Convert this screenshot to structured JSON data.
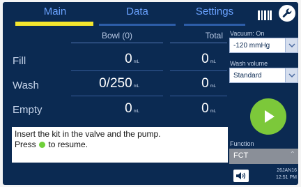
{
  "tabs": [
    {
      "label": "Main",
      "active": true
    },
    {
      "label": "Data",
      "active": false
    },
    {
      "label": "Settings",
      "active": false
    }
  ],
  "icons": {
    "barcode": "barcode-icon",
    "service": "wrench-icon",
    "start": "play-icon",
    "sound": "speaker-icon"
  },
  "table": {
    "headers": {
      "bowl": "Bowl (0)",
      "total": "Total"
    },
    "rows": [
      {
        "label": "Fill",
        "bowl": "0",
        "total": "0",
        "unit": "mL"
      },
      {
        "label": "Wash",
        "bowl": "0/250",
        "total": "0",
        "unit": "mL"
      },
      {
        "label": "Empty",
        "bowl": "0",
        "total": "0",
        "unit": "mL"
      }
    ]
  },
  "message": {
    "line1": "Insert the kit in the valve and the pump.",
    "line2_pre": "Press",
    "line2_post": "to resume."
  },
  "vacuum": {
    "label": "Vacuum: On",
    "value": "-120 mmHg"
  },
  "wash_volume": {
    "label": "Wash volume",
    "value": "Standard"
  },
  "function": {
    "label": "Function",
    "value": "FCT"
  },
  "datetime": {
    "date": "26JAN16",
    "time": "12:51 PM"
  },
  "colors": {
    "background": "#0b2a52",
    "active_tab": "#f4e62e",
    "tab_text": "#6aa2ff",
    "start_button": "#7cc83a"
  }
}
